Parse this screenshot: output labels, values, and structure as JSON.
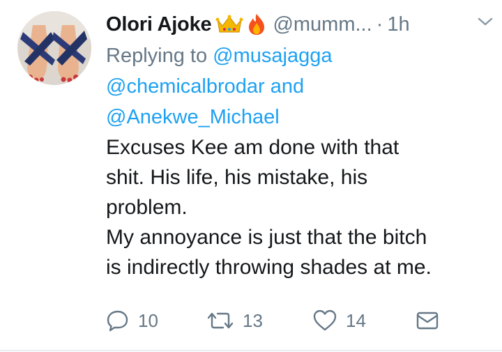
{
  "tweet": {
    "display_name": "Olori Ajoke",
    "handle": "@mumm...",
    "separator": "·",
    "time": "1h",
    "reply_prefix": "Replying to",
    "mentions": [
      "@musajagga",
      "@chemicalbrodar and",
      "@Anekwe_Michael"
    ],
    "body_lines": [
      "Excuses Kee am done with that",
      "shit. His life, his mistake, his",
      "problem.",
      "My annoyance is just that the bitch",
      "is indirectly throwing shades at me."
    ]
  },
  "actions": {
    "reply_count": "10",
    "retweet_count": "13",
    "like_count": "14"
  },
  "icons": {
    "name_emojis": [
      "crown-icon",
      "fire-icon"
    ],
    "caret": "chevron-down-icon",
    "reply": "reply-icon",
    "retweet": "retweet-icon",
    "like": "heart-icon",
    "dm": "mail-icon"
  },
  "colors": {
    "text": "#14171a",
    "muted": "#657786",
    "link": "#1da1f2",
    "divider": "#e6ecf0"
  }
}
